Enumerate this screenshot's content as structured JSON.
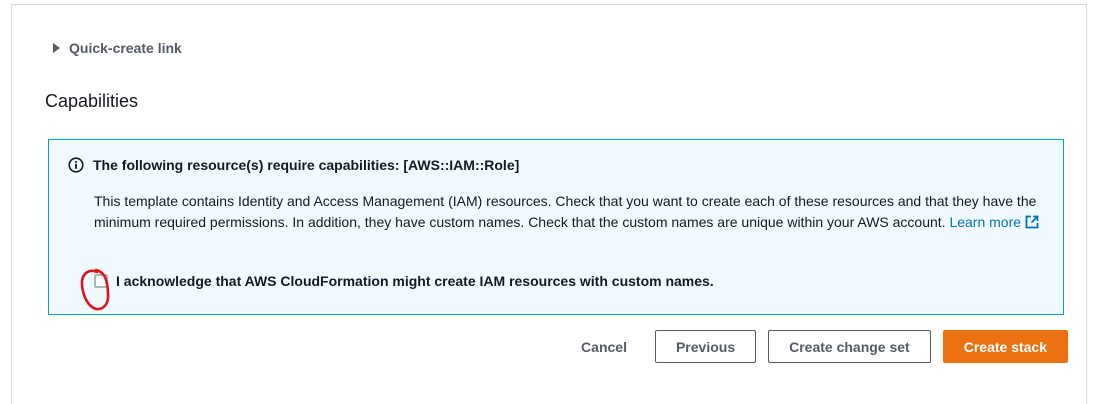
{
  "expander": {
    "label": "Quick-create link"
  },
  "capabilities": {
    "title": "Capabilities",
    "alert": {
      "heading": "The following resource(s) require capabilities: [AWS::IAM::Role]",
      "body": "This template contains Identity and Access Management (IAM) resources. Check that you want to create each of these resources and that they have the minimum required permissions. In addition, they have custom names. Check that the custom names are unique within your AWS account.",
      "link_text": "Learn more",
      "acknowledge_label": "I acknowledge that AWS CloudFormation might create IAM resources with custom names.",
      "acknowledged": false
    }
  },
  "actions": {
    "cancel": "Cancel",
    "previous": "Previous",
    "create_change_set": "Create change set",
    "create_stack": "Create stack"
  },
  "colors": {
    "primary": "#ec7211",
    "info_border": "#00a1c9",
    "info_background": "#f1faff",
    "link": "#0073bb",
    "annotation": "#e0121f"
  }
}
